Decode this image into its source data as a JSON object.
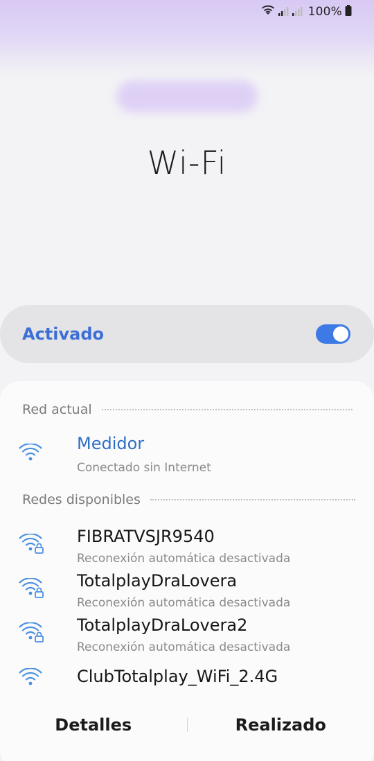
{
  "status_bar": {
    "battery": "100%"
  },
  "title": "Wi-Fi",
  "toggle": {
    "label": "Activado",
    "state": "on"
  },
  "sections": {
    "current": "Red actual",
    "available": "Redes disponibles"
  },
  "current_network": {
    "name": "Medidor",
    "status": "Conectado sin Internet",
    "icon": "wifi-icon"
  },
  "networks": [
    {
      "name": "FIBRATVSJR9540",
      "status": "Reconexión automática desactivada",
      "icon": "wifi-lock-icon"
    },
    {
      "name": "TotalplayDraLovera",
      "status": "Reconexión automática desactivada",
      "icon": "wifi-lock-icon"
    },
    {
      "name": "TotalplayDraLovera2",
      "status": "Reconexión automática desactivada",
      "icon": "wifi-lock-icon"
    },
    {
      "name": "ClubTotalplay_WiFi_2.4G",
      "status": "",
      "icon": "wifi-icon"
    }
  ],
  "buttons": {
    "details": "Detalles",
    "done": "Realizado"
  },
  "colors": {
    "accent": "#3d7ae6",
    "current_network": "#2f6fc4",
    "wifi_icon": "#4a90e2",
    "header_purple": "#d8c9f4"
  }
}
